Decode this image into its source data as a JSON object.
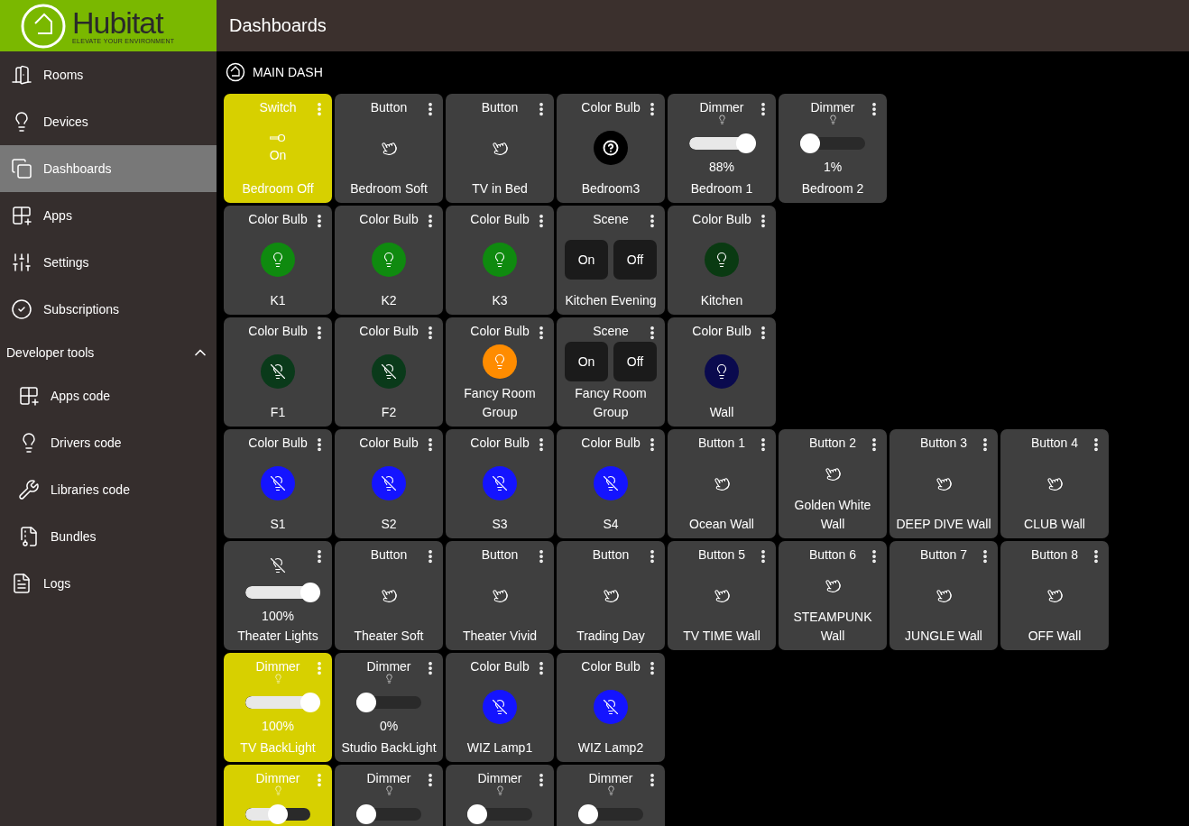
{
  "logo": {
    "name": "Hubitat",
    "tagline": "ELEVATE YOUR ENVIRONMENT"
  },
  "header": {
    "title": "Dashboards"
  },
  "sidebar": {
    "items": [
      {
        "label": "Rooms",
        "selected": false
      },
      {
        "label": "Devices",
        "selected": false
      },
      {
        "label": "Dashboards",
        "selected": true
      },
      {
        "label": "Apps",
        "selected": false
      },
      {
        "label": "Settings",
        "selected": false
      },
      {
        "label": "Subscriptions",
        "selected": false
      }
    ],
    "section": {
      "label": "Developer tools",
      "expanded": true,
      "children": [
        {
          "label": "Apps code"
        },
        {
          "label": "Drivers code"
        },
        {
          "label": "Libraries code"
        },
        {
          "label": "Bundles"
        }
      ]
    },
    "footer_items": [
      {
        "label": "Logs",
        "selected": false
      }
    ]
  },
  "dashboard": {
    "title": "MAIN DASH",
    "rows": [
      {
        "tiles": [
          {
            "kind": "switch",
            "title": "Switch",
            "name": "Bedroom Off",
            "on": true,
            "reading": "On"
          },
          {
            "kind": "button",
            "title": "Button",
            "name": "Bedroom Soft"
          },
          {
            "kind": "button",
            "title": "Button",
            "name": "TV in Bed"
          },
          {
            "kind": "unknown",
            "title": "Color Bulb",
            "name": "Bedroom3",
            "color": "#000000"
          },
          {
            "kind": "dimmer",
            "title": "Dimmer",
            "name": "Bedroom 1",
            "on": false,
            "level": 0.88,
            "reading": "88%"
          },
          {
            "kind": "dimmer",
            "title": "Dimmer",
            "name": "Bedroom 2",
            "on": false,
            "level": 0.01,
            "reading": "1%"
          }
        ]
      },
      {
        "tiles": [
          {
            "kind": "bulb",
            "title": "Color Bulb",
            "name": "K1",
            "lit": true,
            "color": "#0f8a0f"
          },
          {
            "kind": "bulb",
            "title": "Color Bulb",
            "name": "K2",
            "lit": true,
            "color": "#0f8a0f"
          },
          {
            "kind": "bulb",
            "title": "Color Bulb",
            "name": "K3",
            "lit": true,
            "color": "#0f8a0f"
          },
          {
            "kind": "scene",
            "title": "Scene",
            "name": "Kitchen Evening",
            "on_label": "On",
            "off_label": "Off"
          },
          {
            "kind": "bulb",
            "title": "Color Bulb",
            "name": "Kitchen",
            "lit": true,
            "color": "#0a3a12"
          }
        ]
      },
      {
        "tiles": [
          {
            "kind": "bulb",
            "title": "Color Bulb",
            "name": "F1",
            "lit": false,
            "color": "#0a3a1a"
          },
          {
            "kind": "bulb",
            "title": "Color Bulb",
            "name": "F2",
            "lit": false,
            "color": "#0a3a1a"
          },
          {
            "kind": "bulb",
            "title": "Color Bulb",
            "name": "Fancy Room Group",
            "lit": true,
            "color": "#ff8c00"
          },
          {
            "kind": "scene",
            "title": "Scene",
            "name": "Fancy Room Group",
            "on_label": "On",
            "off_label": "Off"
          },
          {
            "kind": "bulb",
            "title": "Color Bulb",
            "name": "Wall",
            "lit": true,
            "color": "#0a0a4e"
          }
        ]
      },
      {
        "tiles": [
          {
            "kind": "bulb",
            "title": "Color Bulb",
            "name": "S1",
            "lit": false,
            "color": "#1414ff"
          },
          {
            "kind": "bulb",
            "title": "Color Bulb",
            "name": "S2",
            "lit": false,
            "color": "#1414ff"
          },
          {
            "kind": "bulb",
            "title": "Color Bulb",
            "name": "S3",
            "lit": false,
            "color": "#1414ff"
          },
          {
            "kind": "bulb",
            "title": "Color Bulb",
            "name": "S4",
            "lit": false,
            "color": "#1414ff"
          },
          {
            "kind": "button",
            "title": "Button 1",
            "name": "Ocean Wall"
          },
          {
            "kind": "button",
            "title": "Button 2",
            "name": "Golden White Wall"
          },
          {
            "kind": "button",
            "title": "Button 3",
            "name": "DEEP DIVE Wall"
          },
          {
            "kind": "button",
            "title": "Button 4",
            "name": "CLUB Wall"
          }
        ]
      },
      {
        "tiles": [
          {
            "kind": "dimmer",
            "name": "Theater Lights",
            "on": false,
            "level": 1,
            "reading": "100%"
          },
          {
            "kind": "button",
            "title": "Button",
            "name": "Theater Soft"
          },
          {
            "kind": "button",
            "title": "Button",
            "name": "Theater Vivid"
          },
          {
            "kind": "button",
            "title": "Button",
            "name": "Trading Day"
          },
          {
            "kind": "button",
            "title": "Button 5",
            "name": "TV TIME Wall"
          },
          {
            "kind": "button",
            "title": "Button 6",
            "name": "STEAMPUNK Wall"
          },
          {
            "kind": "button",
            "title": "Button 7",
            "name": "JUNGLE Wall"
          },
          {
            "kind": "button",
            "title": "Button 8",
            "name": "OFF Wall"
          }
        ]
      },
      {
        "tiles": [
          {
            "kind": "dimmer",
            "title": "Dimmer",
            "name": "TV BackLight",
            "on": true,
            "level": 1,
            "reading": "100%"
          },
          {
            "kind": "dimmer",
            "title": "Dimmer",
            "name": "Studio BackLight",
            "on": false,
            "level": 0,
            "reading": "0%"
          },
          {
            "kind": "bulb",
            "title": "Color Bulb",
            "name": "WIZ Lamp1",
            "lit": false,
            "color": "#1414ff"
          },
          {
            "kind": "bulb",
            "title": "Color Bulb",
            "name": "WIZ Lamp2",
            "lit": false,
            "color": "#1414ff"
          }
        ]
      },
      {
        "tiles": [
          {
            "kind": "dimmer",
            "title": "Dimmer",
            "on": true,
            "level": 0.5
          },
          {
            "kind": "dimmer",
            "title": "Dimmer",
            "on": false,
            "level": 0
          },
          {
            "kind": "dimmer",
            "title": "Dimmer",
            "on": false,
            "level": 0
          },
          {
            "kind": "dimmer",
            "title": "Dimmer",
            "on": false,
            "level": 0
          }
        ]
      }
    ]
  }
}
